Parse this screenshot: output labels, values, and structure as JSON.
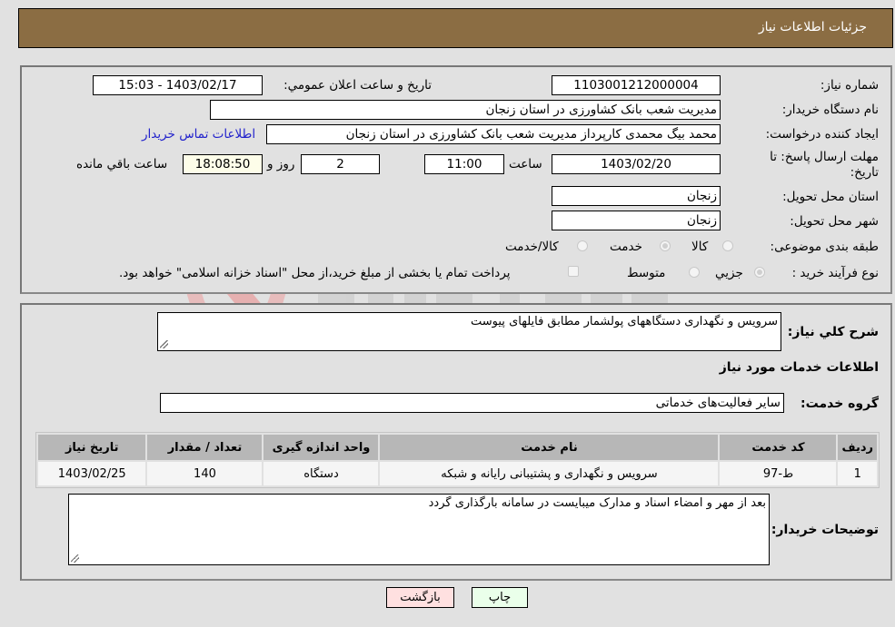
{
  "header": {
    "title": "جزئیات اطلاعات نیاز"
  },
  "form": {
    "need_number": {
      "label": "شماره نیاز:",
      "value": "1103001212000004"
    },
    "announce_datetime": {
      "label": "تاریخ و ساعت اعلان عمومي:",
      "value": "1403/02/17 - 15:03"
    },
    "buyer_org": {
      "label": "نام دستگاه خریدار:",
      "value": "مدیریت شعب بانک کشاورزی در استان زنجان"
    },
    "requester": {
      "label": "ایجاد کننده درخواست:",
      "value": "محمد بیگ محمدی کارپرداز مدیریت شعب بانک کشاورزی در استان زنجان"
    },
    "buyer_contact_link": "اطلاعات تماس خریدار",
    "deadline": {
      "label_line1": "مهلت ارسال پاسخ: تا",
      "label_line2": "تاریخ:",
      "date": "1403/02/20",
      "time_label": "ساعت",
      "time": "11:00",
      "days": "2",
      "days_label": "روز و",
      "remaining": "18:08:50",
      "remaining_label": "ساعت باقي مانده"
    },
    "delivery_province": {
      "label": "استان محل تحویل:",
      "value": "زنجان"
    },
    "delivery_city": {
      "label": "شهر محل تحویل:",
      "value": "زنجان"
    },
    "category": {
      "label": "طبقه بندی موضوعی:",
      "options": [
        "کالا",
        "خدمت",
        "کالا/خدمت"
      ],
      "selected": "خدمت"
    },
    "purchase_process": {
      "label": "نوع فرآیند خرید :",
      "options": [
        "جزيي",
        "متوسط"
      ],
      "selected": "جزيي",
      "treasury_note": "پرداخت تمام یا بخشی از مبلغ خرید،از محل \"اسناد خزانه اسلامی\" خواهد بود."
    }
  },
  "details": {
    "description_label": "شرح كلي نياز:",
    "description": "سرویس و نگهداری دستگاههای پولشمار مطابق فایلهای پیوست",
    "services_heading": "اطلاعات خدمات مورد نیاز",
    "service_group_label": "گروه خدمت:",
    "service_group": "سایر فعالیت‌های خدماتی",
    "table": {
      "headers": [
        "ردیف",
        "کد خدمت",
        "نام خدمت",
        "واحد اندازه گیری",
        "تعداد / مقدار",
        "تاریخ نیاز"
      ],
      "rows": [
        [
          "1",
          "ط-97",
          "سرویس و نگهداری و پشتیبانی رایانه و شبکه",
          "دستگاه",
          "140",
          "1403/02/25"
        ]
      ]
    },
    "buyer_notes_label": "توضیحات خریدار:",
    "buyer_notes": "بعد از مهر و امضاء  اسناد و مدارک میبایست در سامانه بارگذاری گردد"
  },
  "buttons": {
    "print": "چاپ",
    "back": "بازگشت"
  },
  "colors": {
    "header_bg": "#8b6d43",
    "print_bg": "#eaffea",
    "back_bg": "#ffe0e0",
    "link": "#2222cc"
  }
}
